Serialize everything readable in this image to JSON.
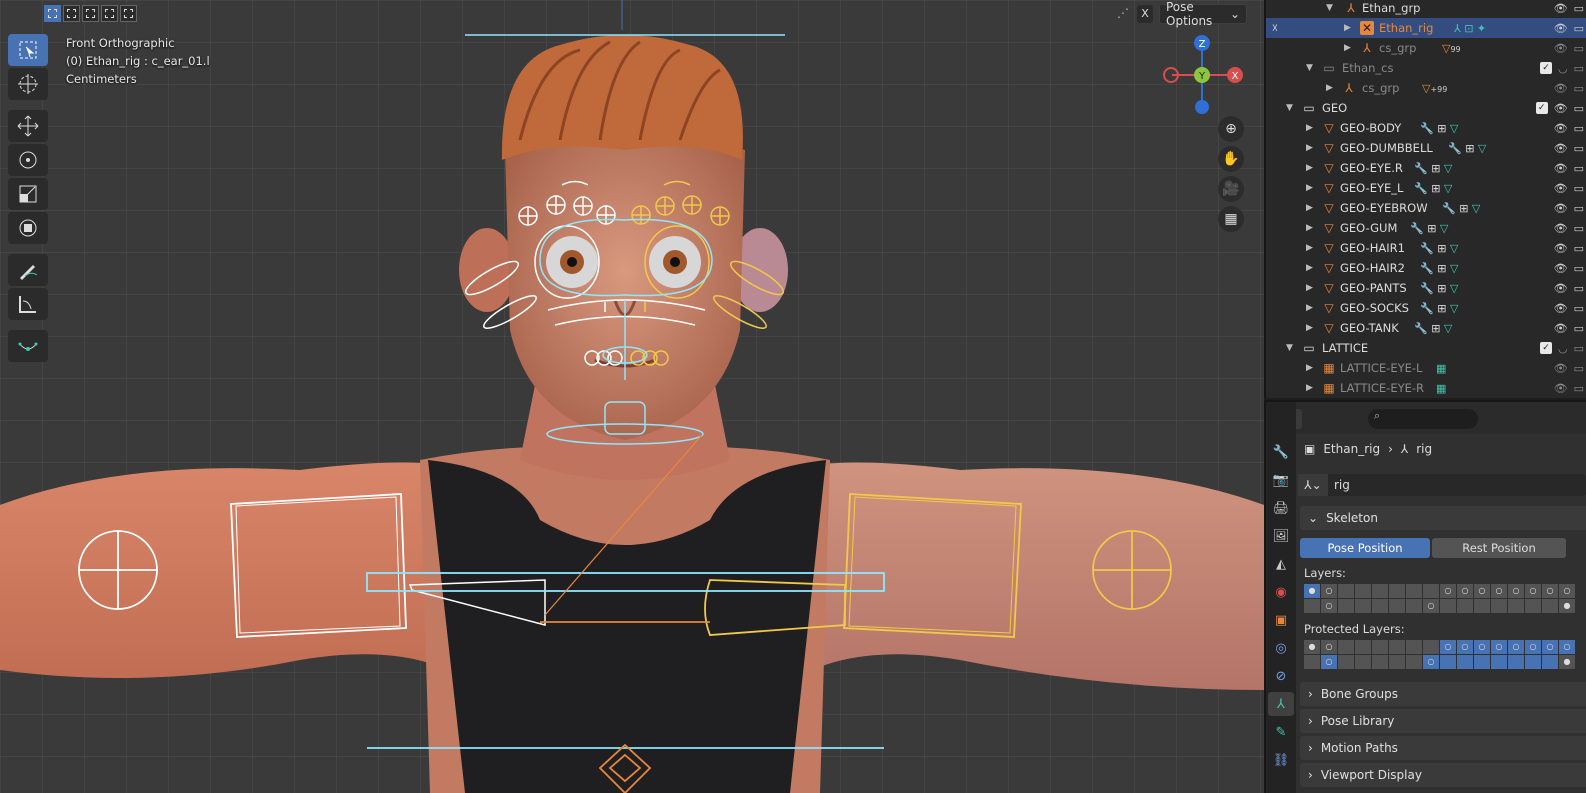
{
  "viewport": {
    "view_name": "Front Orthographic",
    "active_object": "(0) Ethan_rig : c_ear_01.l",
    "units": "Centimeters",
    "pose_options_label": "Pose Options",
    "x_button_label": "X",
    "gizmo_axes": {
      "x": "X",
      "y": "Y",
      "z": "Z"
    },
    "colors": {
      "skin": "#c9826a",
      "tank": "#1f1f21",
      "hair": "#c06a3b",
      "bone_selected": "#f0c94a",
      "bone_cyan": "#8fe6ff",
      "bone_orange": "#e8873a",
      "bone_white": "#ffffff"
    }
  },
  "toolbar": {
    "tools": [
      {
        "name": "select-box",
        "glyph": "⬚"
      },
      {
        "name": "cursor",
        "glyph": "⊕"
      },
      {
        "name": "move",
        "glyph": "✥"
      },
      {
        "name": "rotate",
        "glyph": "↻"
      },
      {
        "name": "scale",
        "glyph": "⤡"
      },
      {
        "name": "transform",
        "glyph": "⊞"
      },
      {
        "name": "annotate",
        "glyph": "✎"
      },
      {
        "name": "measure",
        "glyph": "📐"
      },
      {
        "name": "relax",
        "glyph": "⌒"
      }
    ]
  },
  "outliner": {
    "rows": [
      {
        "label": "Ethan_grp",
        "indent": 3,
        "icon": "armature-empty-icon"
      },
      {
        "label": "Ethan_rig",
        "indent": 4,
        "icon": "armature-icon",
        "selected": true
      },
      {
        "label": "cs_grp",
        "indent": 4,
        "icon": "empty-icon",
        "extra": "99",
        "dim": true
      },
      {
        "label": "Ethan_cs",
        "indent": 2,
        "icon": "collection-icon",
        "dim": true
      },
      {
        "label": "cs_grp",
        "indent": 3,
        "icon": "empty-icon",
        "extra": "+99",
        "dim": true
      },
      {
        "label": "GEO",
        "indent": 1,
        "icon": "collection-icon"
      },
      {
        "label": "GEO-BODY",
        "indent": 2,
        "icon": "mesh-icon"
      },
      {
        "label": "GEO-DUMBBELL",
        "indent": 2,
        "icon": "mesh-icon"
      },
      {
        "label": "GEO-EYE.R",
        "indent": 2,
        "icon": "mesh-icon"
      },
      {
        "label": "GEO-EYE_L",
        "indent": 2,
        "icon": "mesh-icon"
      },
      {
        "label": "GEO-EYEBROW",
        "indent": 2,
        "icon": "mesh-icon"
      },
      {
        "label": "GEO-GUM",
        "indent": 2,
        "icon": "mesh-icon"
      },
      {
        "label": "GEO-HAIR1",
        "indent": 2,
        "icon": "mesh-icon"
      },
      {
        "label": "GEO-HAIR2",
        "indent": 2,
        "icon": "mesh-icon"
      },
      {
        "label": "GEO-PANTS",
        "indent": 2,
        "icon": "mesh-icon"
      },
      {
        "label": "GEO-SOCKS",
        "indent": 2,
        "icon": "mesh-icon"
      },
      {
        "label": "GEO-TANK",
        "indent": 2,
        "icon": "mesh-icon"
      },
      {
        "label": "LATTICE",
        "indent": 1,
        "icon": "collection-icon"
      },
      {
        "label": "LATTICE-EYE-L",
        "indent": 2,
        "icon": "lattice-icon",
        "dim": true
      },
      {
        "label": "LATTICE-EYE-R",
        "indent": 2,
        "icon": "lattice-icon",
        "dim": true
      }
    ]
  },
  "properties": {
    "breadcrumb_object": "Ethan_rig",
    "breadcrumb_data": "rig",
    "data_name": "rig",
    "skeleton_label": "Skeleton",
    "pose_position_label": "Pose Position",
    "rest_position_label": "Rest Position",
    "layers_label": "Layers:",
    "protected_layers_label": "Protected Layers:",
    "bone_groups_label": "Bone Groups",
    "pose_library_label": "Pose Library",
    "motion_paths_label": "Motion Paths",
    "viewport_display_label": "Viewport Display"
  }
}
